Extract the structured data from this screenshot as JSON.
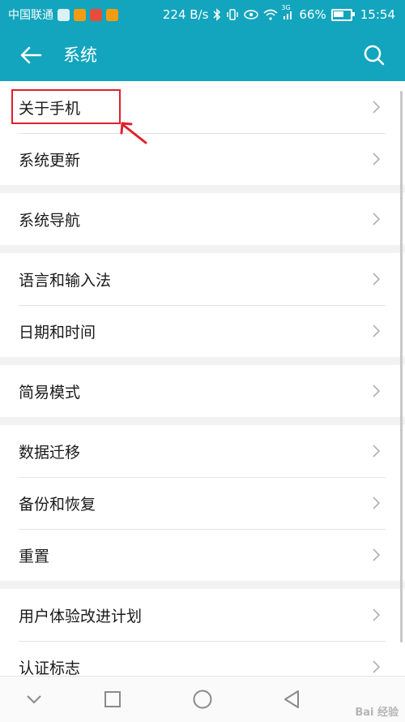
{
  "status_bar": {
    "carrier": "中国联通",
    "speed": "224 B/s",
    "network": "3G",
    "battery": "66%",
    "battery_level": 0.66,
    "time": "15:54"
  },
  "app_bar": {
    "title": "系统",
    "back_icon": "back-arrow-icon",
    "search_icon": "search-icon"
  },
  "groups": [
    {
      "items": [
        {
          "label": "关于手机"
        },
        {
          "label": "系统更新"
        }
      ]
    },
    {
      "items": [
        {
          "label": "系统导航"
        }
      ]
    },
    {
      "items": [
        {
          "label": "语言和输入法"
        },
        {
          "label": "日期和时间"
        }
      ]
    },
    {
      "items": [
        {
          "label": "简易模式"
        }
      ]
    },
    {
      "items": [
        {
          "label": "数据迁移"
        },
        {
          "label": "备份和恢复"
        },
        {
          "label": "重置"
        }
      ]
    },
    {
      "items": [
        {
          "label": "用户体验改进计划"
        },
        {
          "label": "认证标志"
        }
      ]
    }
  ],
  "nav_bar": {
    "icons": [
      "chevron-down-icon",
      "square-icon",
      "circle-icon",
      "triangle-back-icon"
    ]
  },
  "watermark": "Bai 经验",
  "colors": {
    "accent": "#12a5bd",
    "highlight": "#e0202a"
  }
}
